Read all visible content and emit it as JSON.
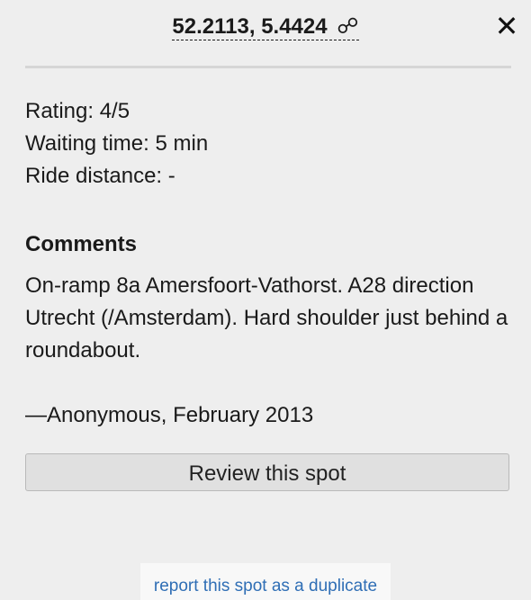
{
  "header": {
    "coordinates": "52.2113, 5.4424",
    "link_icon": "☍",
    "close_icon": "✕"
  },
  "spot": {
    "rating": "Rating: 4/5",
    "waiting_time": "Waiting time: 5 min",
    "ride_distance": "Ride distance: -"
  },
  "comments": {
    "heading": "Comments",
    "text": "On-ramp 8a Amersfoort-Vathorst. A28 direction Utrecht (/Amsterdam). Hard shoulder just behind a roundabout.",
    "author": "—Anonymous, February 2013"
  },
  "actions": {
    "review_label": "Review this spot",
    "report_duplicate_label": "report this spot as a duplicate"
  },
  "colors": {
    "background": "#eeeeee",
    "link": "#2f6eb5",
    "button_bg": "#e0e0e0"
  }
}
